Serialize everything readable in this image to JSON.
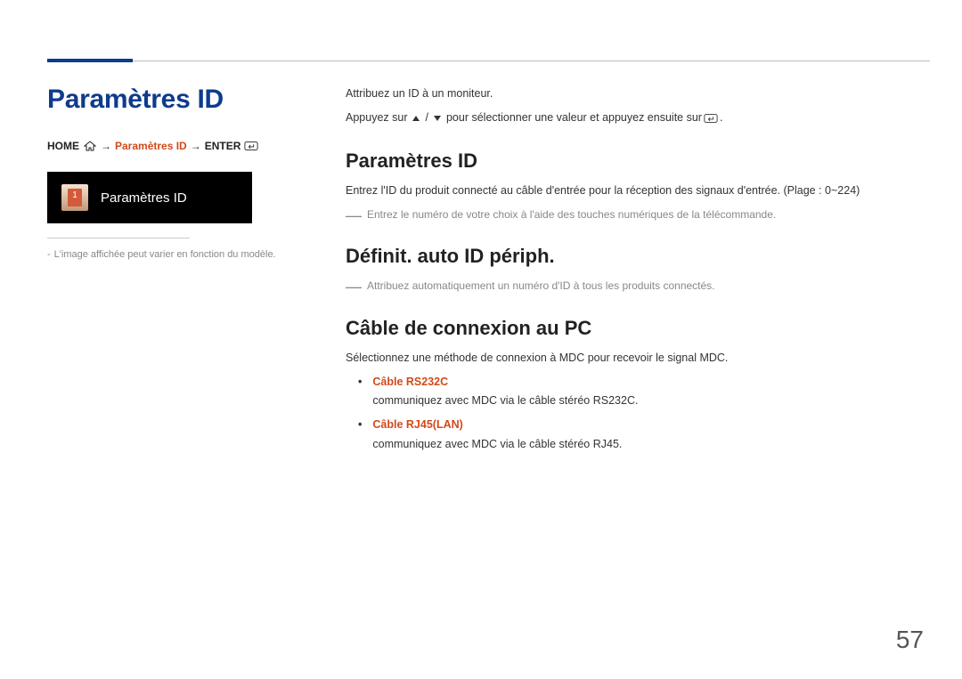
{
  "title": "Paramètres ID",
  "breadcrumb": {
    "home": "HOME",
    "path": "Paramètres ID",
    "enter": "ENTER"
  },
  "menu_card": {
    "label": "Paramètres ID"
  },
  "footnote": "L'image affichée peut varier en fonction du modèle.",
  "intro1": "Attribuez un ID à un moniteur.",
  "intro2_pre": "Appuyez sur",
  "intro2_post": "pour sélectionner une valeur et appuyez ensuite sur",
  "section1": {
    "heading": "Paramètres ID",
    "text": "Entrez l'ID du produit connecté au câble d'entrée pour la réception des signaux d'entrée. (Plage : 0~224)",
    "note": "Entrez le numéro de votre choix à l'aide des touches numériques de la télécommande."
  },
  "section2": {
    "heading": "Définit. auto ID périph.",
    "note": "Attribuez automatiquement un numéro d'ID à tous les produits connectés."
  },
  "section3": {
    "heading": "Câble de connexion au PC",
    "text": "Sélectionnez une méthode de connexion à MDC pour recevoir le signal MDC.",
    "bullets": [
      {
        "title": "Câble RS232C",
        "desc": "communiquez avec MDC via le câble stéréo RS232C."
      },
      {
        "title": "Câble RJ45(LAN)",
        "desc": "communiquez avec MDC via le câble stéréo RJ45."
      }
    ]
  },
  "page_number": "57"
}
